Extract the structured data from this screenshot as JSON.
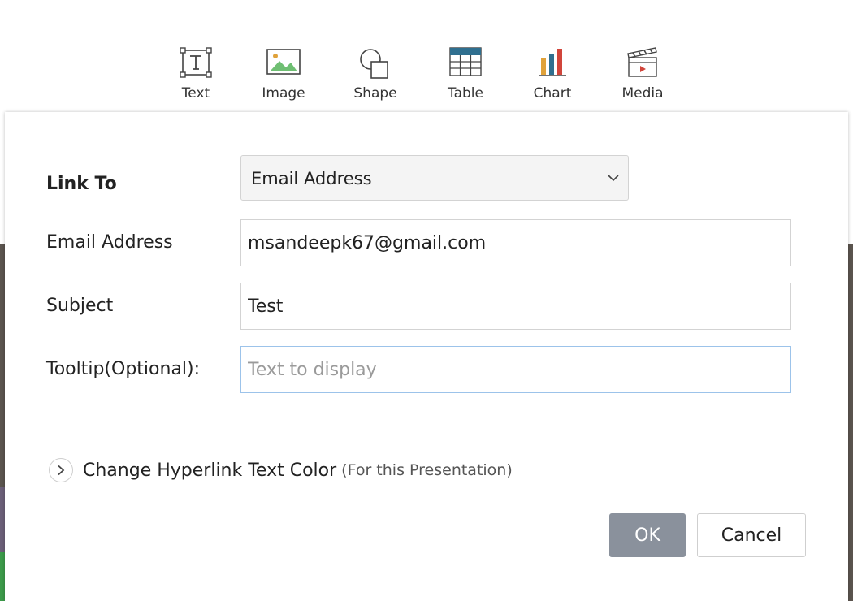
{
  "toolbar": {
    "items": [
      {
        "label": "Text",
        "icon": "text-box-icon"
      },
      {
        "label": "Image",
        "icon": "image-icon"
      },
      {
        "label": "Shape",
        "icon": "shape-icon"
      },
      {
        "label": "Table",
        "icon": "table-icon"
      },
      {
        "label": "Chart",
        "icon": "bar-chart-icon"
      },
      {
        "label": "Media",
        "icon": "clapperboard-icon"
      }
    ]
  },
  "dialog": {
    "link_to": {
      "label": "Link To",
      "selected": "Email Address"
    },
    "email": {
      "label": "Email Address",
      "value": "msandeepk67@gmail.com"
    },
    "subject": {
      "label": "Subject",
      "value": "Test"
    },
    "tooltip": {
      "label": "Tooltip(Optional):",
      "value": "",
      "placeholder": "Text to display"
    },
    "hyperlink_color": {
      "label": "Change Hyperlink Text Color",
      "note": "(For this Presentation)"
    },
    "ok_label": "OK",
    "cancel_label": "Cancel"
  },
  "colors": {
    "ok_button": "#8a919c",
    "focus_border": "#9cc3ea",
    "table_header": "#2f6f8f",
    "chart_bars": [
      "#e0a23a",
      "#2f6f8f",
      "#d1453b"
    ],
    "image_mountain": "#6fbf73"
  }
}
